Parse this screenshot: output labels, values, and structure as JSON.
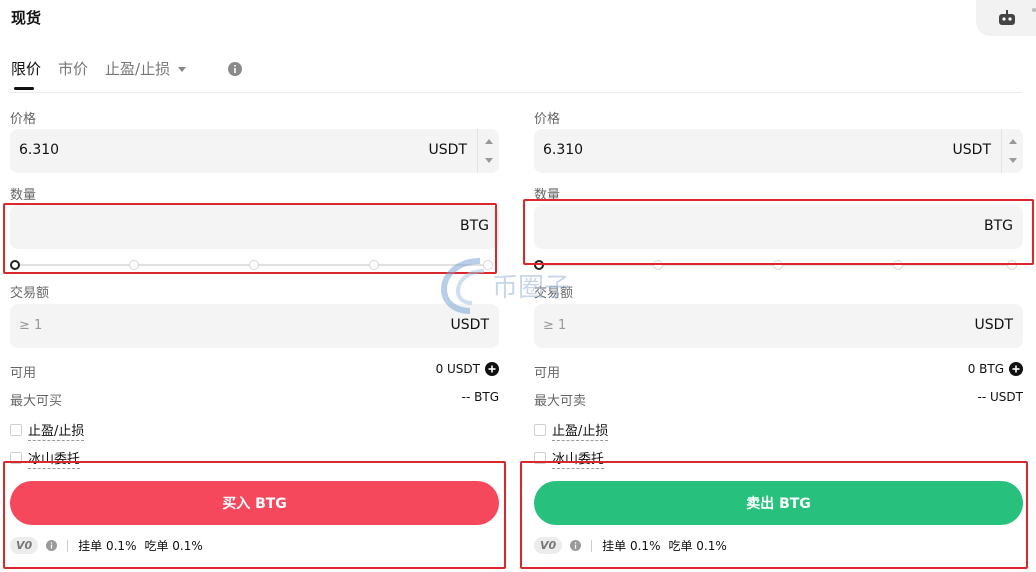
{
  "header": {
    "title": "现货"
  },
  "tabs": [
    {
      "label": "限价",
      "active": true
    },
    {
      "label": "市价",
      "active": false
    },
    {
      "label": "止盈/止损",
      "active": false
    }
  ],
  "buy": {
    "price_label": "价格",
    "price_value": "6.310",
    "price_unit": "USDT",
    "qty_label": "数量",
    "qty_unit": "BTG",
    "amount_label": "交易额",
    "amount_placeholder": "≥ 1",
    "amount_unit": "USDT",
    "available_label": "可用",
    "available_value": "0 USDT",
    "max_label": "最大可买",
    "max_value": "-- BTG",
    "tpsl_label": "止盈/止损",
    "iceberg_label": "冰山委托",
    "button_label": "买入 BTG",
    "button_color": "#f5485d",
    "vip": "V0",
    "maker_fee": "挂单 0.1%",
    "taker_fee": "吃单 0.1%"
  },
  "sell": {
    "price_label": "价格",
    "price_value": "6.310",
    "price_unit": "USDT",
    "qty_label": "数量",
    "qty_unit": "BTG",
    "amount_label": "交易额",
    "amount_placeholder": "≥ 1",
    "amount_unit": "USDT",
    "available_label": "可用",
    "available_value": "0 BTG",
    "max_label": "最大可卖",
    "max_value": "-- USDT",
    "tpsl_label": "止盈/止损",
    "iceberg_label": "冰山委托",
    "button_label": "卖出 BTG",
    "button_color": "#27c17d",
    "vip": "V0",
    "maker_fee": "挂单 0.1%",
    "taker_fee": "吃单 0.1%"
  },
  "watermark": {
    "text": "币圈子"
  },
  "icons": [
    "robot-icon",
    "info-icon",
    "plus-circle-icon",
    "chevron-down-icon"
  ]
}
